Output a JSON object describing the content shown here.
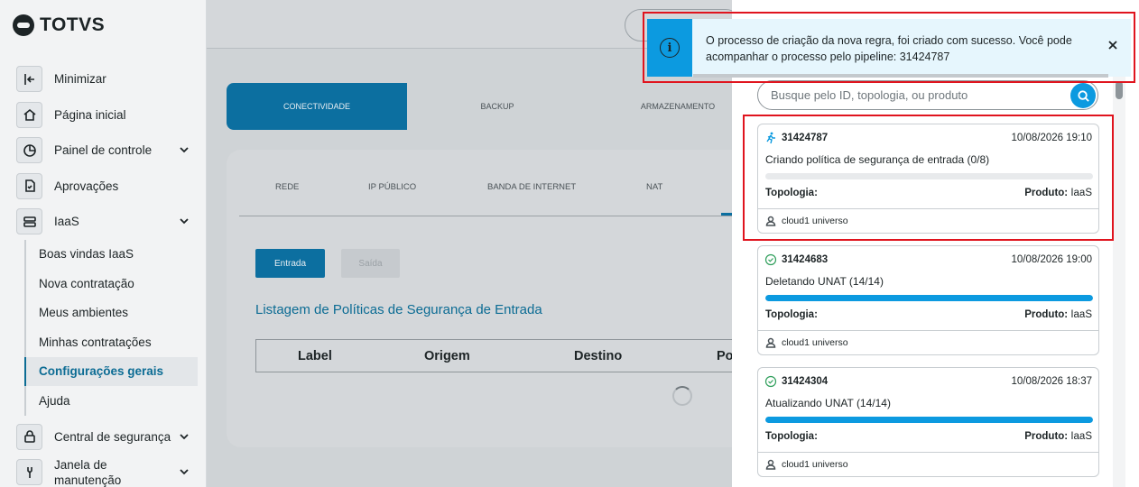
{
  "brand": {
    "name": "TOTVS"
  },
  "sidebar": {
    "items": [
      {
        "label": "Minimizar",
        "icon": "collapse-icon",
        "chevron": false
      },
      {
        "label": "Página inicial",
        "icon": "home-icon",
        "chevron": false
      },
      {
        "label": "Painel de controle",
        "icon": "pie-chart-icon",
        "chevron": true
      },
      {
        "label": "Aprovações",
        "icon": "document-check-icon",
        "chevron": false
      },
      {
        "label": "IaaS",
        "icon": "server-icon",
        "chevron": true
      }
    ],
    "iaas_sub": [
      {
        "label": "Boas vindas IaaS"
      },
      {
        "label": "Nova contratação"
      },
      {
        "label": "Meus ambientes"
      },
      {
        "label": "Minhas contratações"
      },
      {
        "label": "Configurações gerais",
        "active": true
      },
      {
        "label": "Ajuda"
      }
    ],
    "bottom_items": [
      {
        "label": "Central de segurança",
        "icon": "lock-icon",
        "chevron": true
      },
      {
        "label": "Janela de manutenção",
        "icon": "wrench-icon",
        "chevron": true
      }
    ]
  },
  "main": {
    "category_tabs": [
      "CONECTIVIDADE",
      "BACKUP",
      "ARMAZENAMENTO"
    ],
    "sub_tabs": [
      "REDE",
      "IP PÚBLICO",
      "BANDA DE INTERNET",
      "NAT"
    ],
    "direction_buttons": {
      "entrada": "Entrada",
      "saida": "Saída"
    },
    "list_title": "Listagem de Políticas de Segurança de Entrada",
    "table_headers": [
      "Label",
      "Origem",
      "Destino",
      "Po"
    ]
  },
  "toast": {
    "message": "O processo de criação da nova regra, foi criado com sucesso. Você pode acompanhar o processo pelo pipeline: 31424787",
    "icon": "info-icon"
  },
  "panel": {
    "search_placeholder": "Busque pelo ID, topologia, ou produto",
    "pipelines": [
      {
        "id": "31424787",
        "date": "10/08/2026 19:10",
        "description": "Criando política de segurança de entrada (0/8)",
        "progress": 0.0,
        "status_icon": "running-icon",
        "topology_label": "Topologia:",
        "product_label": "Produto:",
        "product": "IaaS",
        "user": "cloud1 universo"
      },
      {
        "id": "31424683",
        "date": "10/08/2026 19:00",
        "description": "Deletando UNAT (14/14)",
        "progress": 1.0,
        "status_icon": "check-circle-icon",
        "topology_label": "Topologia:",
        "product_label": "Produto:",
        "product": "IaaS",
        "user": "cloud1 universo"
      },
      {
        "id": "31424304",
        "date": "10/08/2026 18:37",
        "description": "Atualizando UNAT (14/14)",
        "progress": 1.0,
        "status_icon": "check-circle-icon",
        "topology_label": "Topologia:",
        "product_label": "Produto:",
        "product": "IaaS",
        "user": "cloud1 universo"
      }
    ]
  },
  "colors": {
    "accent": "#0c9ae0",
    "primary_dark": "#0c6fa0",
    "highlight": "#e0141e",
    "toast_bg": "#e6f6fd"
  }
}
